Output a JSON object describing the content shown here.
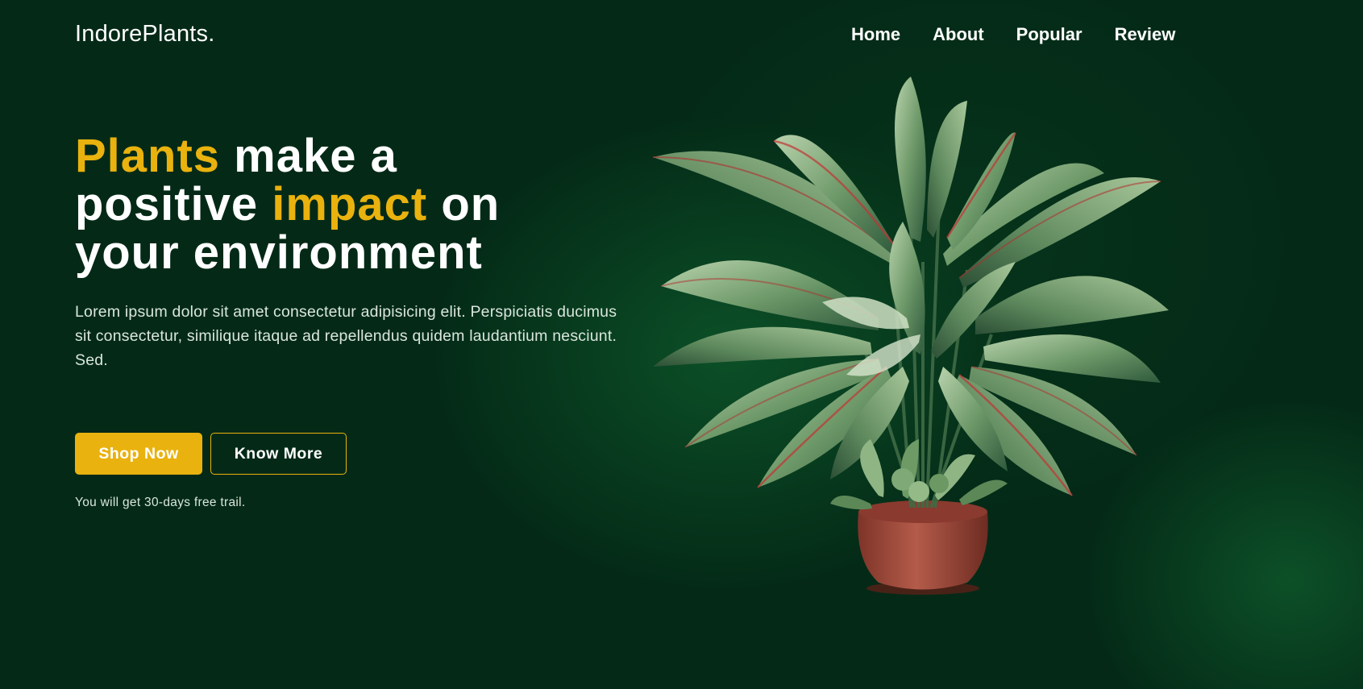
{
  "brand": {
    "logo": "IndorePlants."
  },
  "nav": {
    "items": [
      {
        "label": "Home"
      },
      {
        "label": "About"
      },
      {
        "label": "Popular"
      },
      {
        "label": "Review"
      }
    ]
  },
  "hero": {
    "title_parts": [
      {
        "text": "Plants",
        "highlight": true
      },
      {
        "text": " make a",
        "highlight": false
      },
      {
        "text": "positive ",
        "highlight": false
      },
      {
        "text": "impact",
        "highlight": true
      },
      {
        "text": " on",
        "highlight": false
      },
      {
        "text": "your environment",
        "highlight": false
      }
    ],
    "description": "Lorem ipsum dolor sit amet consectetur adipisicing elit. Perspiciatis ducimus sit consectetur, similique itaque ad repellendus quidem laudantium nesciunt. Sed.",
    "primary_button": "Shop Now",
    "secondary_button": "Know More",
    "trial_note": "You will get 30-days free trail."
  },
  "media": {
    "image_name": "potted-plant-image"
  },
  "colors": {
    "background": "#042a17",
    "accent": "#e9b20e",
    "text": "#ffffff",
    "muted_text": "#d9e6dd",
    "leaf": "#6f9a6a",
    "pot": "#a14a3c"
  }
}
